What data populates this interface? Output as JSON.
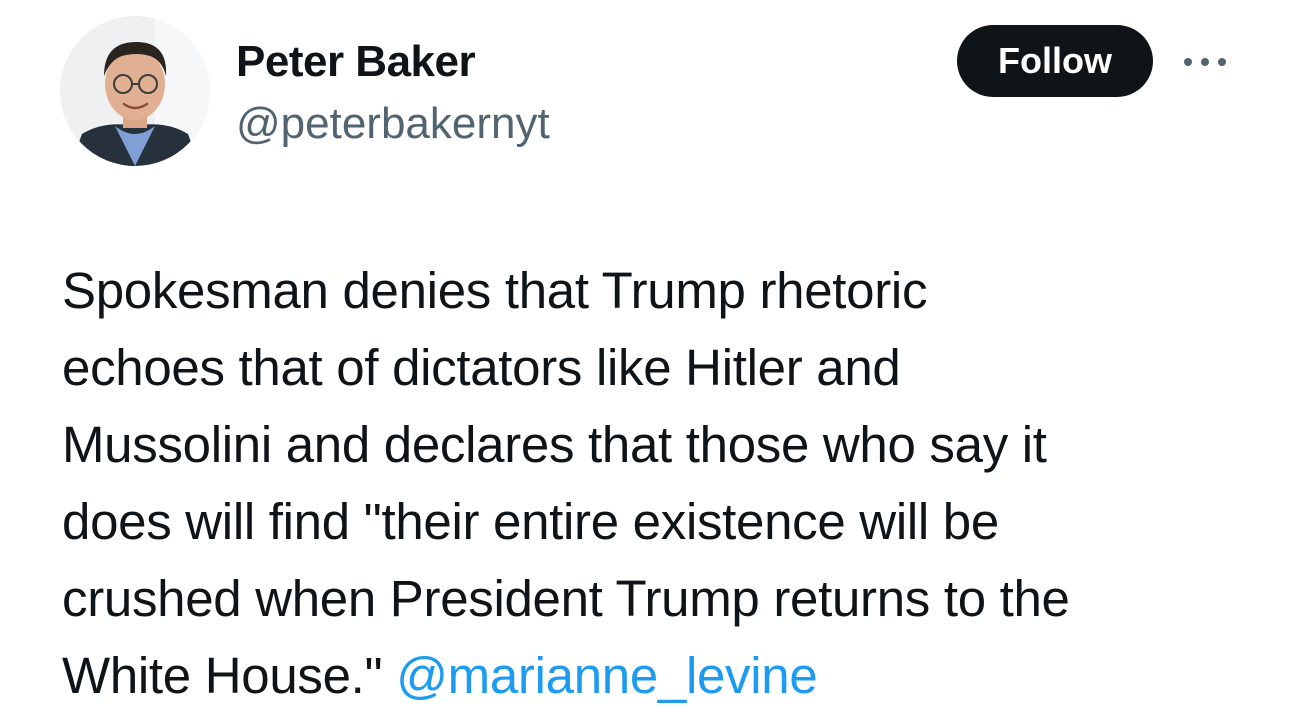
{
  "author": {
    "display_name": "Peter Baker",
    "handle": "@peterbakernyt",
    "avatar_icon": "profile-photo"
  },
  "actions": {
    "follow_label": "Follow",
    "more_icon": "more-options-icon"
  },
  "tweet": {
    "lines": [
      "Spokesman denies that Trump rhetoric",
      "echoes that of dictators like Hitler and",
      "Mussolini and declares that those who say it",
      "does will find \"their entire existence will be",
      "crushed when President Trump returns to the",
      "White House.\" "
    ],
    "mention": "@marianne_levine"
  },
  "colors": {
    "text": "#0f1419",
    "secondary": "#536471",
    "link": "#1d9bf0",
    "button_bg": "#0f1419"
  }
}
